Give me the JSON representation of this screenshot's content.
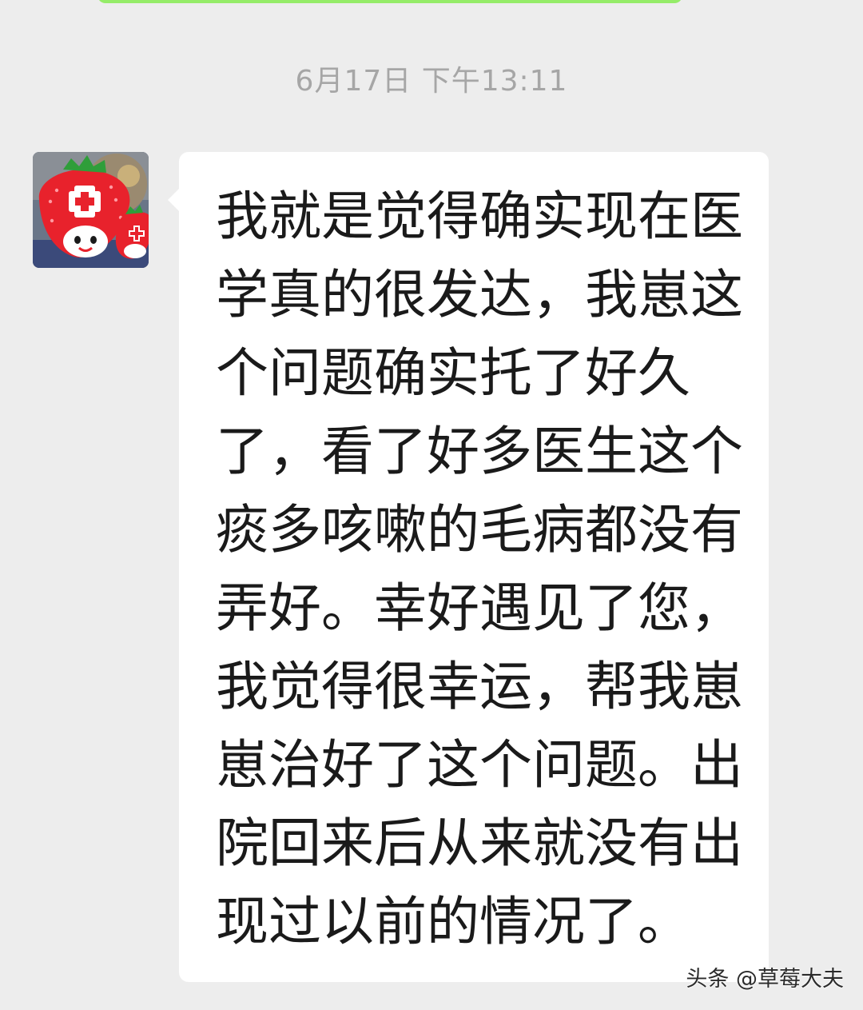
{
  "chat": {
    "timestamp": "6月17日 下午13:11",
    "message": {
      "sender": "other",
      "avatar_icon": "strawberry-doctor-icon",
      "text": "我就是觉得确实现在医学真的很发达，我崽这个问题确实托了好久了，看了好多医生这个痰多咳嗽的毛病都没有弄好。幸好遇见了您，我觉得很幸运，帮我崽崽治好了这个问题。出院回来后从来就没有出现过以前的情况了。"
    }
  },
  "watermark": {
    "text": "头条 @草莓大夫"
  },
  "colors": {
    "background": "#ededed",
    "bubble": "#ffffff",
    "sent_bubble": "#95ec69",
    "timestamp": "#a6a6a6",
    "strawberry": "#e8222c"
  }
}
